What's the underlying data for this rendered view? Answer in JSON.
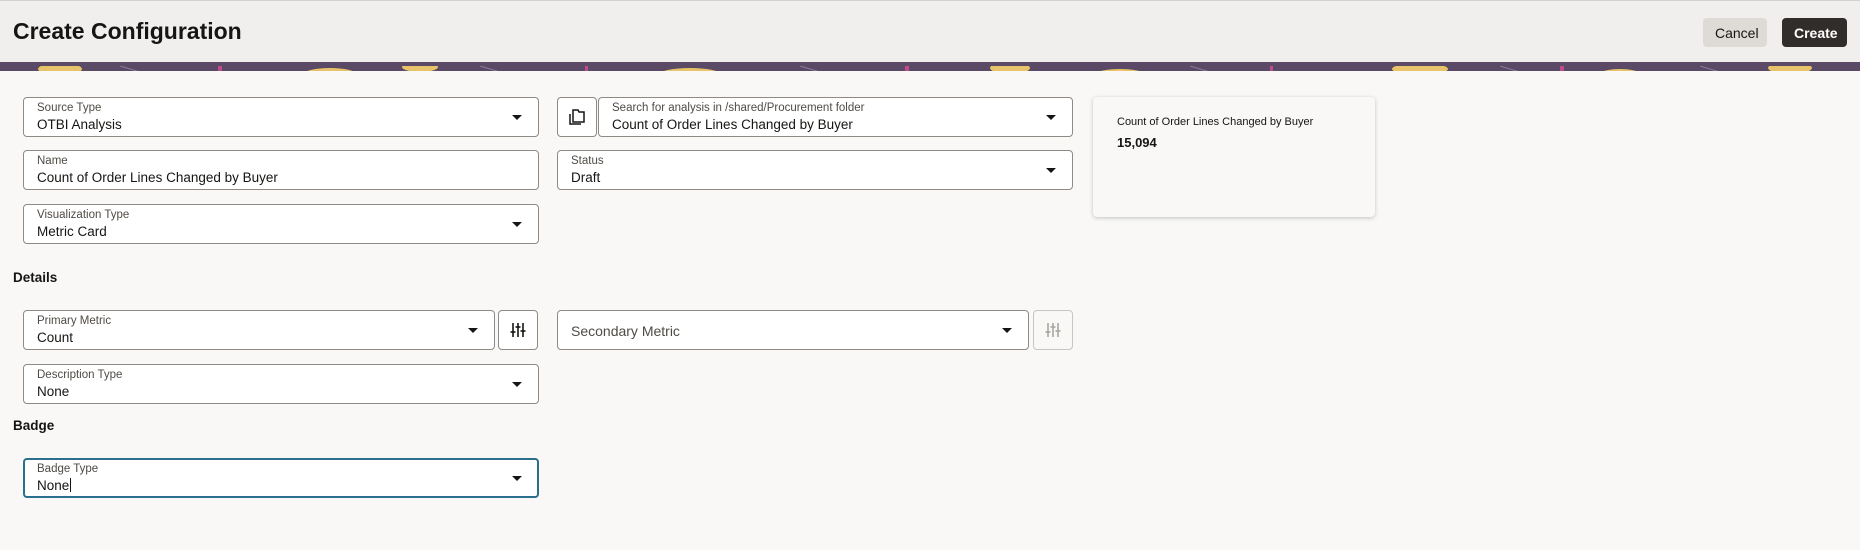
{
  "header": {
    "title": "Create Configuration",
    "cancel_label": "Cancel",
    "create_label": "Create"
  },
  "form": {
    "source_type": {
      "label": "Source Type",
      "value": "OTBI Analysis"
    },
    "analysis_search": {
      "label": "Search for analysis in /shared/Procurement folder",
      "value": "Count of Order Lines Changed by Buyer"
    },
    "name": {
      "label": "Name",
      "value": "Count of Order Lines Changed by Buyer"
    },
    "status": {
      "label": "Status",
      "value": "Draft"
    },
    "visualization_type": {
      "label": "Visualization Type",
      "value": "Metric Card"
    }
  },
  "details": {
    "heading": "Details",
    "primary_metric": {
      "label": "Primary Metric",
      "value": "Count"
    },
    "secondary_metric": {
      "placeholder": "Secondary Metric"
    },
    "description_type": {
      "label": "Description Type",
      "value": "None"
    }
  },
  "badge": {
    "heading": "Badge",
    "badge_type": {
      "label": "Badge Type",
      "value": "None"
    }
  },
  "preview": {
    "title": "Count of Order Lines Changed by Buyer",
    "value": "15,094"
  },
  "icons": {
    "browse": "folder-browse-icon",
    "primary_settings": "sliders-icon",
    "secondary_settings": "sliders-icon"
  },
  "colors": {
    "primary_button": "#312d2a",
    "secondary_button": "#dedbd6",
    "focus_border": "#2b6f8f",
    "banner": "#5a4a66"
  }
}
